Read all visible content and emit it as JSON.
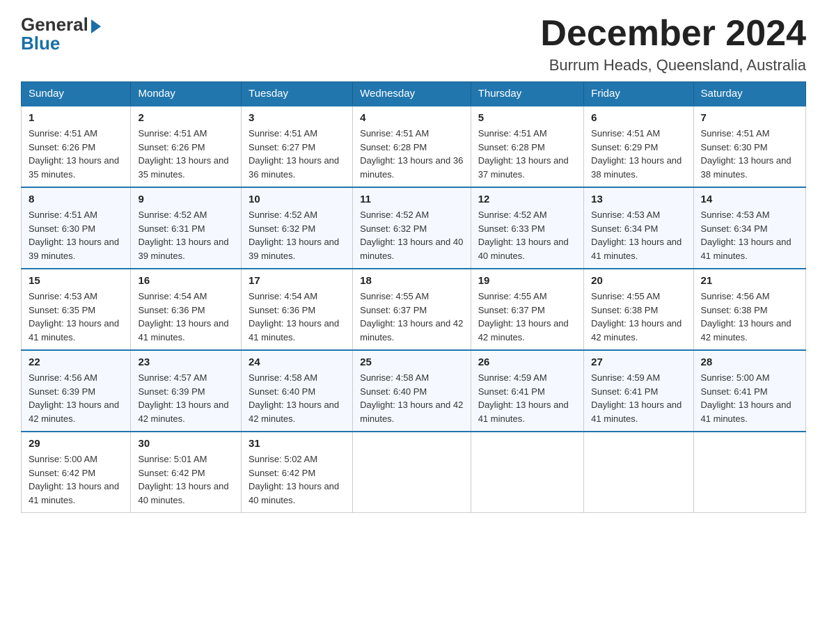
{
  "logo": {
    "general": "General",
    "blue": "Blue"
  },
  "title": "December 2024",
  "subtitle": "Burrum Heads, Queensland, Australia",
  "weekdays": [
    "Sunday",
    "Monday",
    "Tuesday",
    "Wednesday",
    "Thursday",
    "Friday",
    "Saturday"
  ],
  "weeks": [
    [
      {
        "day": "1",
        "sunrise": "Sunrise: 4:51 AM",
        "sunset": "Sunset: 6:26 PM",
        "daylight": "Daylight: 13 hours and 35 minutes."
      },
      {
        "day": "2",
        "sunrise": "Sunrise: 4:51 AM",
        "sunset": "Sunset: 6:26 PM",
        "daylight": "Daylight: 13 hours and 35 minutes."
      },
      {
        "day": "3",
        "sunrise": "Sunrise: 4:51 AM",
        "sunset": "Sunset: 6:27 PM",
        "daylight": "Daylight: 13 hours and 36 minutes."
      },
      {
        "day": "4",
        "sunrise": "Sunrise: 4:51 AM",
        "sunset": "Sunset: 6:28 PM",
        "daylight": "Daylight: 13 hours and 36 minutes."
      },
      {
        "day": "5",
        "sunrise": "Sunrise: 4:51 AM",
        "sunset": "Sunset: 6:28 PM",
        "daylight": "Daylight: 13 hours and 37 minutes."
      },
      {
        "day": "6",
        "sunrise": "Sunrise: 4:51 AM",
        "sunset": "Sunset: 6:29 PM",
        "daylight": "Daylight: 13 hours and 38 minutes."
      },
      {
        "day": "7",
        "sunrise": "Sunrise: 4:51 AM",
        "sunset": "Sunset: 6:30 PM",
        "daylight": "Daylight: 13 hours and 38 minutes."
      }
    ],
    [
      {
        "day": "8",
        "sunrise": "Sunrise: 4:51 AM",
        "sunset": "Sunset: 6:30 PM",
        "daylight": "Daylight: 13 hours and 39 minutes."
      },
      {
        "day": "9",
        "sunrise": "Sunrise: 4:52 AM",
        "sunset": "Sunset: 6:31 PM",
        "daylight": "Daylight: 13 hours and 39 minutes."
      },
      {
        "day": "10",
        "sunrise": "Sunrise: 4:52 AM",
        "sunset": "Sunset: 6:32 PM",
        "daylight": "Daylight: 13 hours and 39 minutes."
      },
      {
        "day": "11",
        "sunrise": "Sunrise: 4:52 AM",
        "sunset": "Sunset: 6:32 PM",
        "daylight": "Daylight: 13 hours and 40 minutes."
      },
      {
        "day": "12",
        "sunrise": "Sunrise: 4:52 AM",
        "sunset": "Sunset: 6:33 PM",
        "daylight": "Daylight: 13 hours and 40 minutes."
      },
      {
        "day": "13",
        "sunrise": "Sunrise: 4:53 AM",
        "sunset": "Sunset: 6:34 PM",
        "daylight": "Daylight: 13 hours and 41 minutes."
      },
      {
        "day": "14",
        "sunrise": "Sunrise: 4:53 AM",
        "sunset": "Sunset: 6:34 PM",
        "daylight": "Daylight: 13 hours and 41 minutes."
      }
    ],
    [
      {
        "day": "15",
        "sunrise": "Sunrise: 4:53 AM",
        "sunset": "Sunset: 6:35 PM",
        "daylight": "Daylight: 13 hours and 41 minutes."
      },
      {
        "day": "16",
        "sunrise": "Sunrise: 4:54 AM",
        "sunset": "Sunset: 6:36 PM",
        "daylight": "Daylight: 13 hours and 41 minutes."
      },
      {
        "day": "17",
        "sunrise": "Sunrise: 4:54 AM",
        "sunset": "Sunset: 6:36 PM",
        "daylight": "Daylight: 13 hours and 41 minutes."
      },
      {
        "day": "18",
        "sunrise": "Sunrise: 4:55 AM",
        "sunset": "Sunset: 6:37 PM",
        "daylight": "Daylight: 13 hours and 42 minutes."
      },
      {
        "day": "19",
        "sunrise": "Sunrise: 4:55 AM",
        "sunset": "Sunset: 6:37 PM",
        "daylight": "Daylight: 13 hours and 42 minutes."
      },
      {
        "day": "20",
        "sunrise": "Sunrise: 4:55 AM",
        "sunset": "Sunset: 6:38 PM",
        "daylight": "Daylight: 13 hours and 42 minutes."
      },
      {
        "day": "21",
        "sunrise": "Sunrise: 4:56 AM",
        "sunset": "Sunset: 6:38 PM",
        "daylight": "Daylight: 13 hours and 42 minutes."
      }
    ],
    [
      {
        "day": "22",
        "sunrise": "Sunrise: 4:56 AM",
        "sunset": "Sunset: 6:39 PM",
        "daylight": "Daylight: 13 hours and 42 minutes."
      },
      {
        "day": "23",
        "sunrise": "Sunrise: 4:57 AM",
        "sunset": "Sunset: 6:39 PM",
        "daylight": "Daylight: 13 hours and 42 minutes."
      },
      {
        "day": "24",
        "sunrise": "Sunrise: 4:58 AM",
        "sunset": "Sunset: 6:40 PM",
        "daylight": "Daylight: 13 hours and 42 minutes."
      },
      {
        "day": "25",
        "sunrise": "Sunrise: 4:58 AM",
        "sunset": "Sunset: 6:40 PM",
        "daylight": "Daylight: 13 hours and 42 minutes."
      },
      {
        "day": "26",
        "sunrise": "Sunrise: 4:59 AM",
        "sunset": "Sunset: 6:41 PM",
        "daylight": "Daylight: 13 hours and 41 minutes."
      },
      {
        "day": "27",
        "sunrise": "Sunrise: 4:59 AM",
        "sunset": "Sunset: 6:41 PM",
        "daylight": "Daylight: 13 hours and 41 minutes."
      },
      {
        "day": "28",
        "sunrise": "Sunrise: 5:00 AM",
        "sunset": "Sunset: 6:41 PM",
        "daylight": "Daylight: 13 hours and 41 minutes."
      }
    ],
    [
      {
        "day": "29",
        "sunrise": "Sunrise: 5:00 AM",
        "sunset": "Sunset: 6:42 PM",
        "daylight": "Daylight: 13 hours and 41 minutes."
      },
      {
        "day": "30",
        "sunrise": "Sunrise: 5:01 AM",
        "sunset": "Sunset: 6:42 PM",
        "daylight": "Daylight: 13 hours and 40 minutes."
      },
      {
        "day": "31",
        "sunrise": "Sunrise: 5:02 AM",
        "sunset": "Sunset: 6:42 PM",
        "daylight": "Daylight: 13 hours and 40 minutes."
      },
      null,
      null,
      null,
      null
    ]
  ]
}
